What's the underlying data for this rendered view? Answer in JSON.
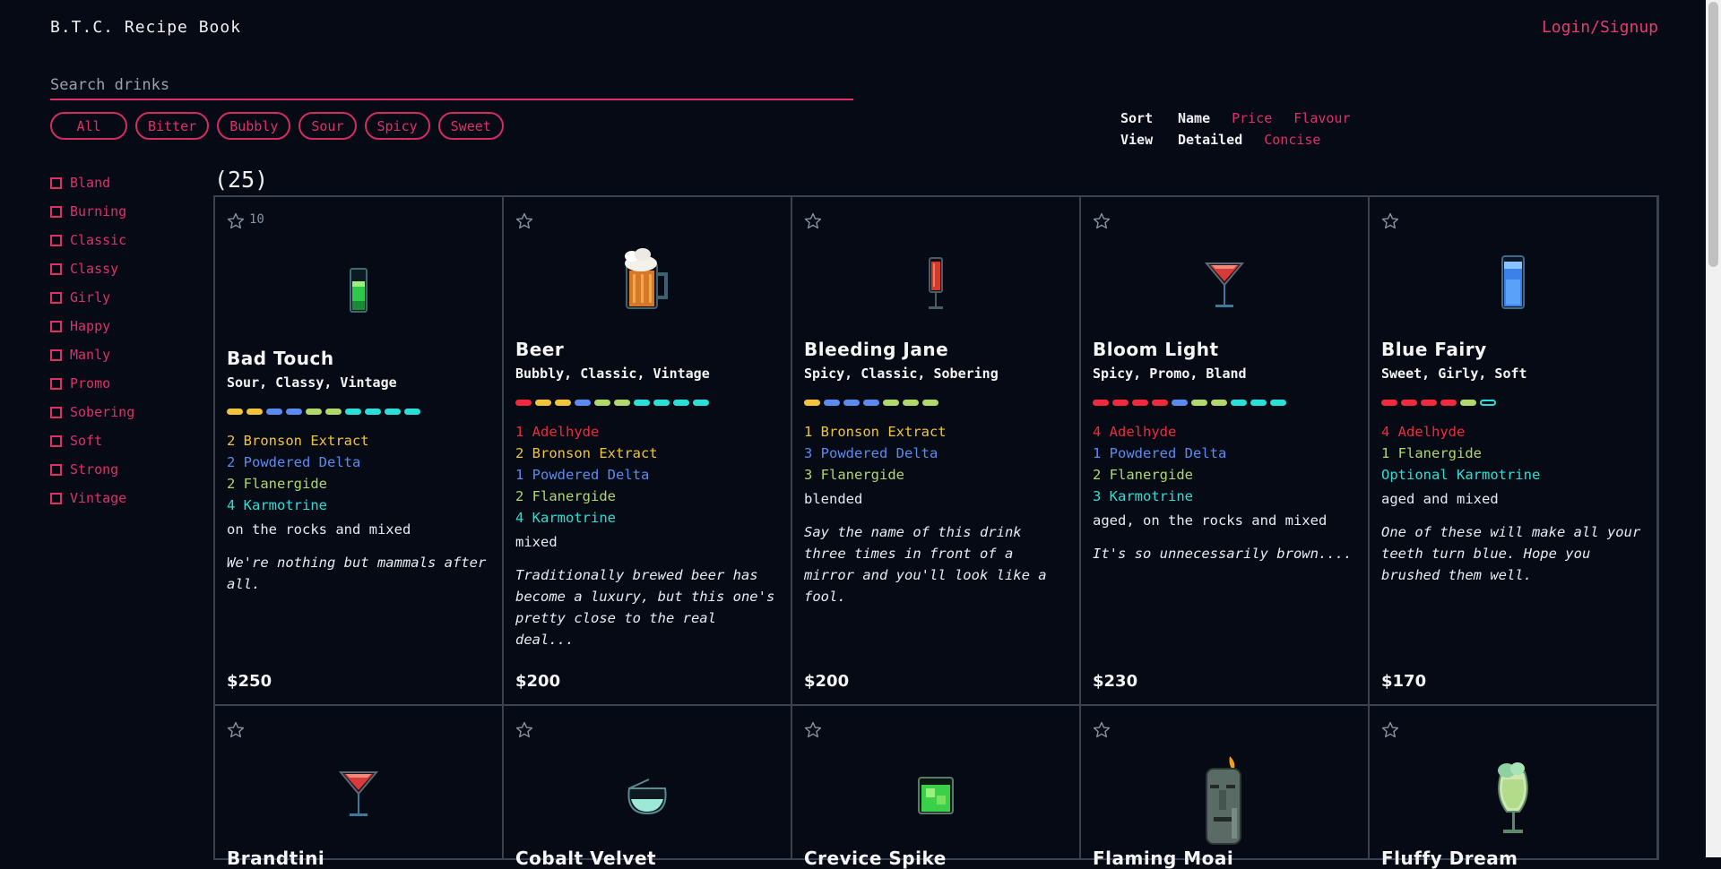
{
  "app": {
    "title": "B.T.C. Recipe Book",
    "login_label": "Login/Signup"
  },
  "search": {
    "placeholder": "Search drinks",
    "value": ""
  },
  "flavour_filters": [
    "All",
    "Bitter",
    "Bubbly",
    "Sour",
    "Spicy",
    "Sweet"
  ],
  "sort": {
    "label": "Sort",
    "options": [
      "Name",
      "Price",
      "Flavour"
    ],
    "selected": "Name"
  },
  "view": {
    "label": "View",
    "options": [
      "Detailed",
      "Concise"
    ],
    "selected": "Detailed"
  },
  "tag_filters": [
    "Bland",
    "Burning",
    "Classic",
    "Classy",
    "Girly",
    "Happy",
    "Manly",
    "Promo",
    "Sobering",
    "Soft",
    "Strong",
    "Vintage"
  ],
  "result_count": "(25)",
  "colors": {
    "accent": "#e0306b",
    "adelhyde": "#ee2a3c",
    "bronson_extract": "#f2c43a",
    "powdered_delta": "#5a8cf0",
    "flanergide": "#b0d86a",
    "karmotrine": "#28e0d8"
  },
  "drinks": [
    {
      "favorites": "10",
      "icon": "green-glass-icon",
      "name": "Bad Touch",
      "tags": "Sour, Classy, Vintage",
      "dots": [
        "bron",
        "bron",
        "powd",
        "powd",
        "flan",
        "flan",
        "karm",
        "karm",
        "karm",
        "karm"
      ],
      "ingredients": [
        {
          "text": "2 Bronson Extract",
          "c": "bron"
        },
        {
          "text": "2 Powdered Delta",
          "c": "powd"
        },
        {
          "text": "2 Flanergide",
          "c": "flan"
        },
        {
          "text": "4 Karmotrine",
          "c": "karm"
        }
      ],
      "method": "on the rocks and mixed",
      "description": "We're nothing but mammals after all.",
      "price": "$250"
    },
    {
      "favorites": "",
      "icon": "beer-mug-icon",
      "name": "Beer",
      "tags": "Bubbly, Classic, Vintage",
      "dots": [
        "adel",
        "bron",
        "bron",
        "powd",
        "flan",
        "flan",
        "karm",
        "karm",
        "karm",
        "karm"
      ],
      "ingredients": [
        {
          "text": "1 Adelhyde",
          "c": "adel"
        },
        {
          "text": "2 Bronson Extract",
          "c": "bron"
        },
        {
          "text": "1 Powdered Delta",
          "c": "powd"
        },
        {
          "text": "2 Flanergide",
          "c": "flan"
        },
        {
          "text": "4 Karmotrine",
          "c": "karm"
        }
      ],
      "method": "mixed",
      "description": "Traditionally brewed beer has become a luxury, but this one's pretty close to the real deal...",
      "price": "$200"
    },
    {
      "favorites": "",
      "icon": "tall-red-glass-icon",
      "name": "Bleeding Jane",
      "tags": "Spicy, Classic, Sobering",
      "dots": [
        "bron",
        "powd",
        "powd",
        "powd",
        "flan",
        "flan",
        "flan"
      ],
      "ingredients": [
        {
          "text": "1 Bronson Extract",
          "c": "bron"
        },
        {
          "text": "3 Powdered Delta",
          "c": "powd"
        },
        {
          "text": "3 Flanergide",
          "c": "flan"
        }
      ],
      "method": "blended",
      "description": "Say the name of this drink three times in front of a mirror and you'll look like a fool.",
      "price": "$200"
    },
    {
      "favorites": "",
      "icon": "martini-glass-icon",
      "name": "Bloom Light",
      "tags": "Spicy, Promo, Bland",
      "dots": [
        "adel",
        "adel",
        "adel",
        "adel",
        "powd",
        "flan",
        "flan",
        "karm",
        "karm",
        "karm"
      ],
      "ingredients": [
        {
          "text": "4 Adelhyde",
          "c": "adel"
        },
        {
          "text": "1 Powdered Delta",
          "c": "powd"
        },
        {
          "text": "2 Flanergide",
          "c": "flan"
        },
        {
          "text": "3 Karmotrine",
          "c": "karm"
        }
      ],
      "method": "aged, on the rocks and mixed",
      "description": "It's so unnecessarily brown....",
      "price": "$230"
    },
    {
      "favorites": "",
      "icon": "blue-glass-icon",
      "name": "Blue Fairy",
      "tags": "Sweet, Girly, Soft",
      "dots": [
        "adel",
        "adel",
        "adel",
        "adel",
        "flan",
        "karm-hollow"
      ],
      "ingredients": [
        {
          "text": "4 Adelhyde",
          "c": "adel"
        },
        {
          "text": "1 Flanergide",
          "c": "flan"
        },
        {
          "text": "Optional Karmotrine",
          "c": "karm"
        }
      ],
      "method": "aged and mixed",
      "description": "One of these will make all your teeth turn blue. Hope you brushed them well.",
      "price": "$170"
    },
    {
      "favorites": "",
      "icon": "martini-glass-icon",
      "name": "Brandtini"
    },
    {
      "favorites": "",
      "icon": "snifter-glass-icon",
      "name": "Cobalt Velvet"
    },
    {
      "favorites": "",
      "icon": "green-rocks-glass-icon",
      "name": "Crevice Spike"
    },
    {
      "favorites": "",
      "icon": "moai-statue-icon",
      "name": "Flaming Moai"
    },
    {
      "favorites": "",
      "icon": "hurricane-glass-icon",
      "name": "Fluffy Dream"
    }
  ]
}
